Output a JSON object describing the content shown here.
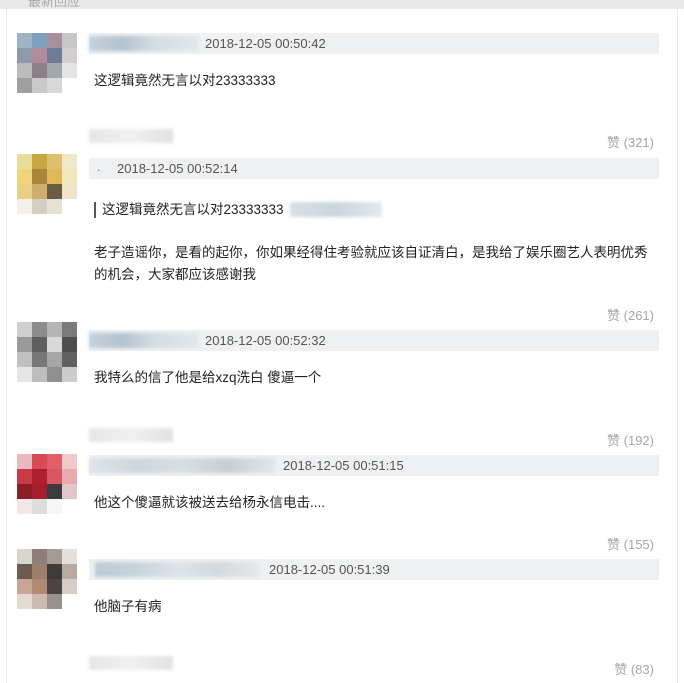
{
  "section": {
    "title": "最新回应"
  },
  "comments": [
    {
      "timestamp": "2018-12-05 00:50:42",
      "text": "这逻辑竟然无言以对23333333",
      "likes": "赞 (321)",
      "avatar_colors": [
        "#9fb3c4",
        "#7fa0bd",
        "#a88f9c",
        "#c7c7c7",
        "#8e9aab",
        "#b08c9a",
        "#6c7d93",
        "#d2cdd0",
        "#bcbcbc",
        "#8e7f86",
        "#a0a8b0",
        "#e4e4e4",
        "#9f9f9f",
        "#c9c9c9",
        "#d8d8d8",
        "#ffffff"
      ]
    },
    {
      "timestamp": "2018-12-05 00:52:14",
      "quote": "这逻辑竟然无言以对23333333",
      "text": "老子造谣你，是看的起你，你如果经得住考验就应该自证清白，是我给了娱乐圈艺人表明优秀的机会，大家都应该感谢我",
      "likes": "赞 (261)",
      "avatar_colors": [
        "#e9dd9c",
        "#c9a640",
        "#dcc070",
        "#eee9c8",
        "#f0d47a",
        "#a8853a",
        "#e0b85a",
        "#f2e6bb",
        "#e8cf85",
        "#cfae6a",
        "#6b5a44",
        "#ece3c9",
        "#f2f0e8",
        "#d5cfc2",
        "#e7e1d3",
        "#ffffff"
      ]
    },
    {
      "timestamp": "2018-12-05 00:52:32",
      "text": "我特么的信了他是给xzq洗白 傻逼一个",
      "likes": "赞 (192)",
      "avatar_colors": [
        "#cfcfcf",
        "#8c8c8c",
        "#b5b5b5",
        "#7a7a7a",
        "#9a9a9a",
        "#5f5f5f",
        "#d8d8d8",
        "#4e4e4e",
        "#c0c0c0",
        "#777777",
        "#a6a6a6",
        "#616161",
        "#e6e6e6",
        "#bdbdbd",
        "#8f8f8f",
        "#cccccc"
      ]
    },
    {
      "timestamp": "2018-12-05 00:51:15",
      "text": "他这个傻逼就该被送去给杨永信电击....",
      "likes": "赞 (155)",
      "avatar_colors": [
        "#e8b9bf",
        "#d84a55",
        "#e0606a",
        "#f0c9cc",
        "#c93a48",
        "#b01e30",
        "#d75763",
        "#e9a9af",
        "#8b1c28",
        "#a41e2e",
        "#3b3b3b",
        "#e1c6c9",
        "#f3e6e7",
        "#dcdcdc",
        "#f6f6f6",
        "#ffffff"
      ]
    },
    {
      "timestamp": "2018-12-05 00:51:39",
      "text": "他脑子有病",
      "likes": "赞 (83)",
      "avatar_colors": [
        "#d9d4d0",
        "#8d7f78",
        "#a79a93",
        "#e4dfdc",
        "#6e5a50",
        "#9e7f6c",
        "#3e3a38",
        "#b7aaa2",
        "#c9a694",
        "#b08a74",
        "#4a4442",
        "#d8ccc6",
        "#e6d9d2",
        "#cdbab0",
        "#9a918c",
        "#ffffff"
      ]
    }
  ]
}
